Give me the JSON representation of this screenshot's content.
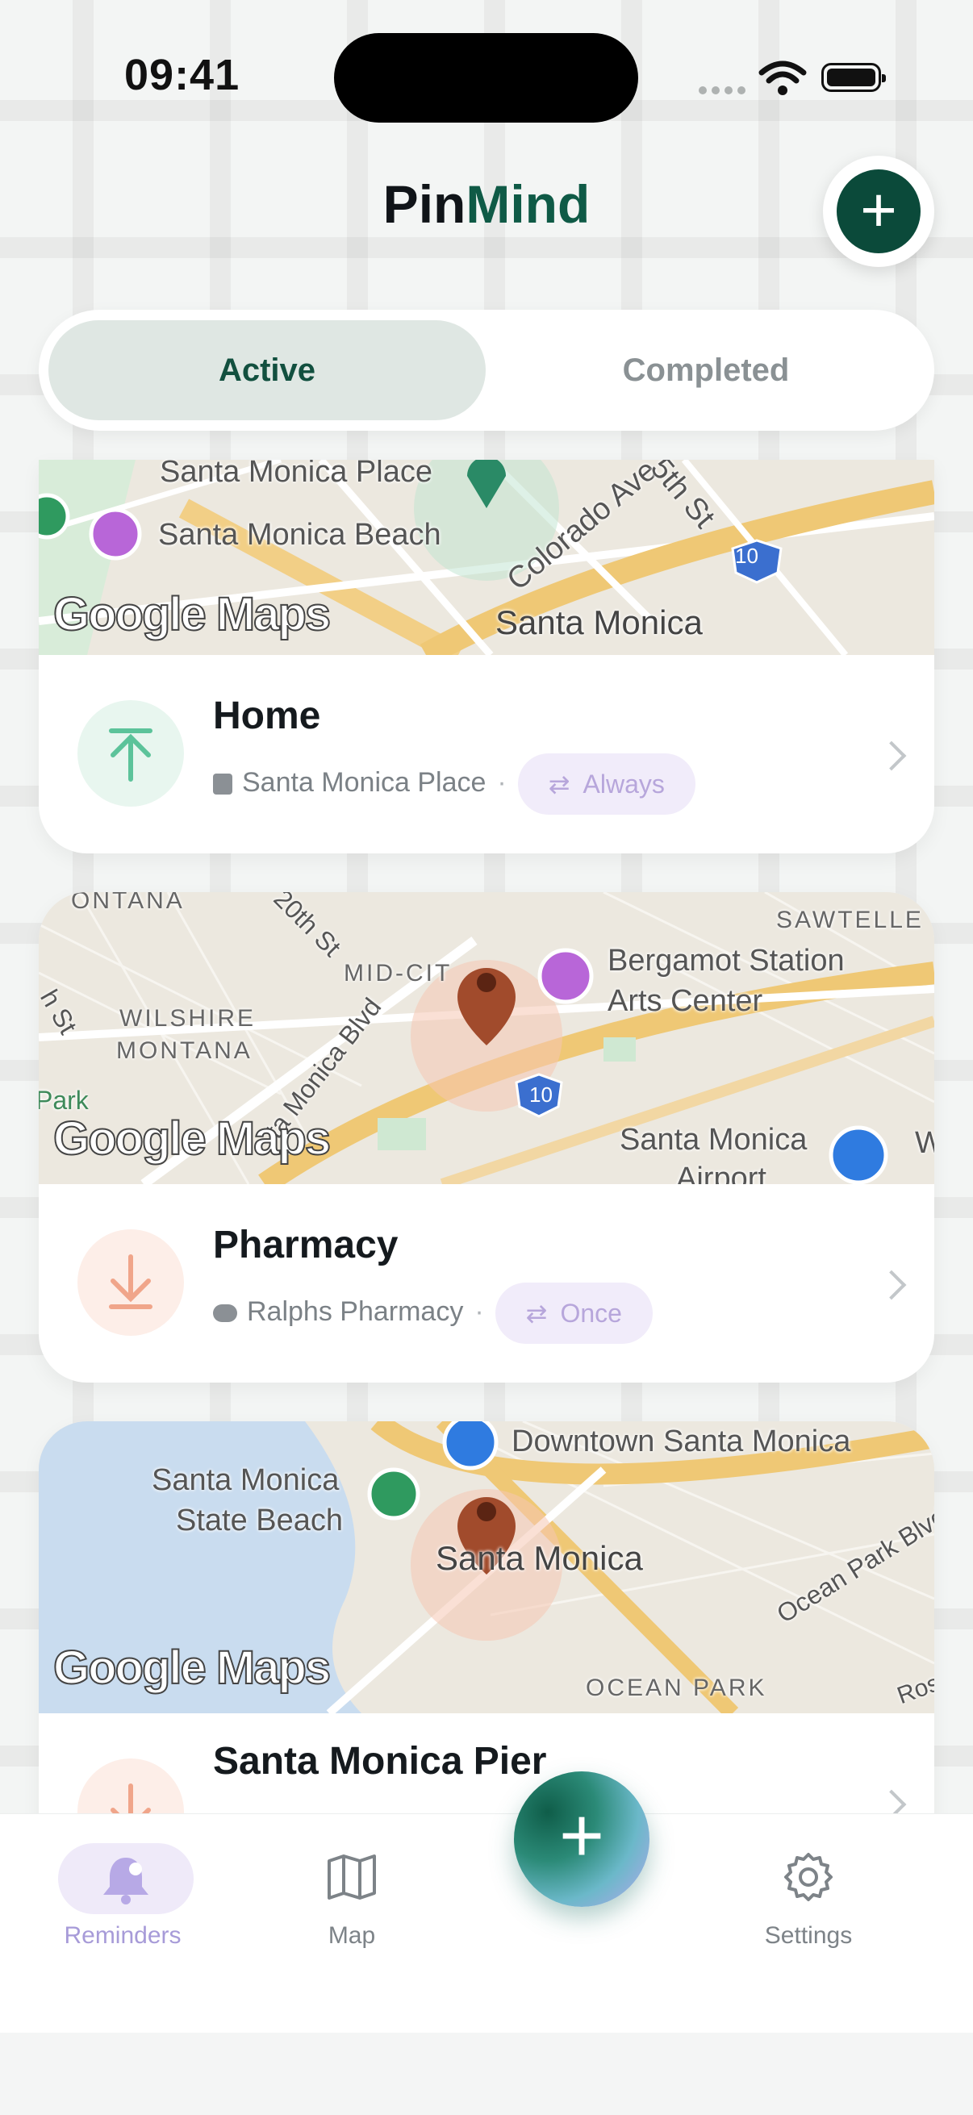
{
  "status": {
    "time": "09:41"
  },
  "header": {
    "title_a": "Pin",
    "title_b": "Mind"
  },
  "segment": {
    "active": "Active",
    "completed": "Completed"
  },
  "colors": {
    "brand": "#0b4a3a",
    "accent_purple": "#a79bd8",
    "pin": "#a14b2c"
  },
  "cards": [
    {
      "title": "Home",
      "location_icon": "bag-icon",
      "location": "Santa Monica Place",
      "repeat": "Always",
      "map_labels": [
        "Santa Monica Place",
        "Santa Monica Beach",
        "Colorado Ave",
        "5th St",
        "Santa Monica",
        "10"
      ],
      "map_brand": "Google Maps",
      "icon": "arrow-up-icon"
    },
    {
      "title": "Pharmacy",
      "location_icon": "pills-icon",
      "location": "Ralphs Pharmacy",
      "repeat": "Once",
      "map_labels": [
        "ONTANA",
        "20th St",
        "SAWTELLE",
        "MID-CIT",
        "Bergamot Station",
        "Arts Center",
        "WILSHIRE",
        "MONTANA",
        "ta Monica Blvd",
        "h St",
        "Park",
        "Santa Monica",
        "Airport",
        "10",
        "W"
      ],
      "map_brand": "Google Maps",
      "icon": "arrow-down-icon"
    },
    {
      "title": "Santa Monica Pier",
      "map_labels": [
        "Downtown Santa Monica",
        "Santa Monica",
        "State Beach",
        "Santa Monica",
        "Ocean Park Blvd",
        "OCEAN PARK",
        "Ros"
      ],
      "map_brand": "Google Maps",
      "icon": "arrow-down-icon"
    }
  ],
  "nav": {
    "reminders": "Reminders",
    "map": "Map",
    "settings": "Settings"
  },
  "fab": {
    "symbol": "+"
  },
  "add_top": {
    "symbol": "+"
  }
}
